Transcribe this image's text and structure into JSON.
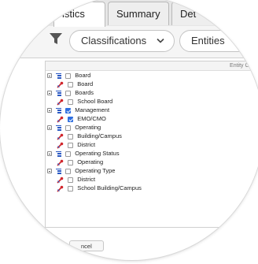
{
  "tabs": [
    {
      "label": "Statistics",
      "visible_label": "istics",
      "active": true
    },
    {
      "label": "Summary",
      "active": false
    },
    {
      "label": "Details",
      "visible_label": "Det",
      "active": false
    }
  ],
  "filters": {
    "classifications_label": "Classifications",
    "entities_label": "Entities"
  },
  "panel": {
    "column_header": "Entity Class"
  },
  "tree": [
    {
      "label": "Board",
      "level": 0,
      "checked": false
    },
    {
      "label": "Board",
      "level": 1,
      "checked": false
    },
    {
      "label": "Boards",
      "level": 0,
      "checked": false
    },
    {
      "label": "School Board",
      "level": 1,
      "checked": false
    },
    {
      "label": "Management",
      "level": 0,
      "checked": true
    },
    {
      "label": "EMO/CMO",
      "level": 1,
      "checked": true
    },
    {
      "label": "Operating",
      "level": 0,
      "checked": false
    },
    {
      "label": "Building/Campus",
      "level": 1,
      "checked": false
    },
    {
      "label": "District",
      "level": 1,
      "checked": false
    },
    {
      "label": "Operating Status",
      "level": 0,
      "checked": false
    },
    {
      "label": "Operating",
      "level": 1,
      "checked": false
    },
    {
      "label": "Operating Type",
      "level": 0,
      "checked": false
    },
    {
      "label": "District",
      "level": 1,
      "checked": false
    },
    {
      "label": "School Building/Campus",
      "level": 1,
      "checked": false
    }
  ],
  "bottom_button": {
    "label": "ncel"
  },
  "colors": {
    "accent": "#2f6fe0",
    "tree_icon": "#2b59c3",
    "wand_red": "#d1262c"
  }
}
